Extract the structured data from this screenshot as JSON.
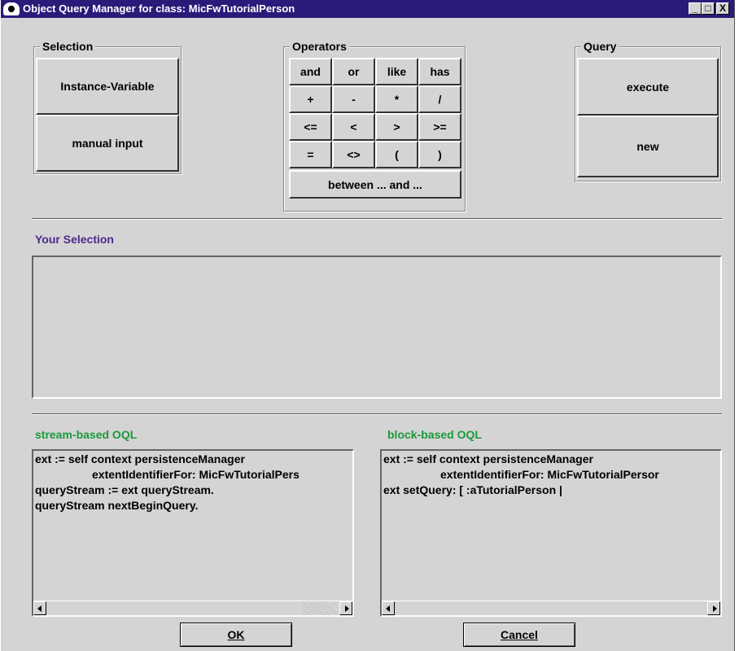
{
  "window": {
    "title": "Object Query Manager for class: MicFwTutorialPerson",
    "minimize_glyph": "_",
    "maximize_glyph": "□",
    "close_glyph": "X"
  },
  "selection": {
    "legend": "Selection",
    "instance_variable": "Instance-Variable",
    "manual_input": "manual input"
  },
  "operators": {
    "legend": "Operators",
    "rows": [
      [
        "and",
        "or",
        "like",
        "has"
      ],
      [
        "+",
        "-",
        "*",
        "/"
      ],
      [
        "<=",
        "<",
        ">",
        ">="
      ],
      [
        "=",
        "<>",
        "(",
        ")"
      ]
    ],
    "between": "between ... and ..."
  },
  "query": {
    "legend": "Query",
    "execute": "execute",
    "new": "new"
  },
  "your_selection": {
    "label": "Your Selection",
    "label_color": "#4b2a8c"
  },
  "stream_oql": {
    "label": "stream-based OQL",
    "label_color": "#1a9a3a",
    "lines": [
      "ext := self context persistenceManager",
      "extentIdentifierFor: MicFwTutorialPers",
      "queryStream := ext queryStream.",
      "queryStream nextBeginQuery."
    ]
  },
  "block_oql": {
    "label": "block-based OQL",
    "label_color": "#1a9a3a",
    "lines": [
      "ext := self context persistenceManager",
      "extentIdentifierFor: MicFwTutorialPersor",
      "ext setQuery: [ :aTutorialPerson |"
    ]
  },
  "buttons": {
    "ok": "OK",
    "cancel": "Cancel"
  }
}
